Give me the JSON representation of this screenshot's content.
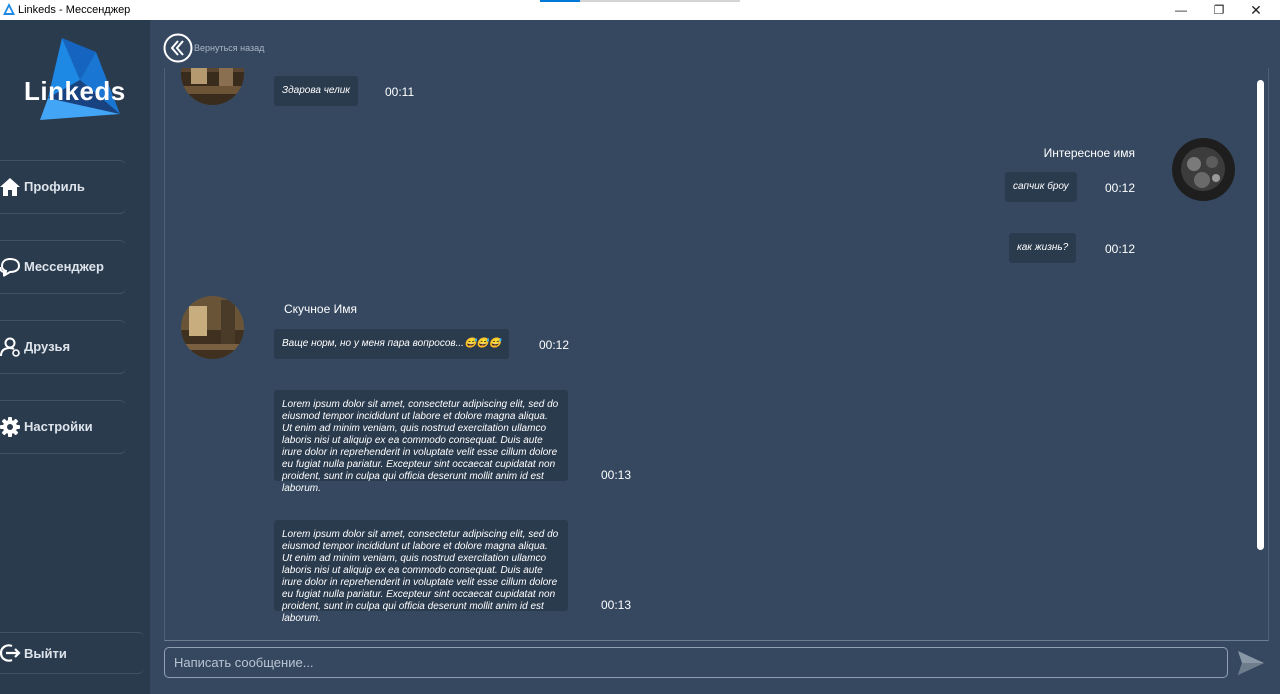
{
  "window": {
    "title": "Linkeds - Мессенджер",
    "minimize": "—",
    "maximize": "❐",
    "close": "✕"
  },
  "sidebar": {
    "logo_text": "Linkeds",
    "items": [
      {
        "label": "Профиль",
        "icon": "home-icon"
      },
      {
        "label": "Мессенджер",
        "icon": "chat-icon"
      },
      {
        "label": "Друзья",
        "icon": "user-icon"
      },
      {
        "label": "Настройки",
        "icon": "gear-icon"
      }
    ],
    "logout": {
      "label": "Выйти",
      "icon": "logout-icon"
    }
  },
  "header": {
    "back_label": "Вернуться назад"
  },
  "messages": [
    {
      "side": "left",
      "sender": "",
      "text": "Здарова челик",
      "time": "00:11"
    },
    {
      "side": "right",
      "sender": "Интересное имя",
      "text": "сапчик броу",
      "time": "00:12"
    },
    {
      "side": "right",
      "sender": "",
      "text": "как жизнь?",
      "time": "00:12"
    },
    {
      "side": "left",
      "sender": "Скучное Имя",
      "text": "Ваще норм, но у меня пара вопросов...😅😅😅",
      "time": "00:12"
    },
    {
      "side": "left",
      "sender": "",
      "text": "Lorem ipsum dolor sit amet, consectetur adipiscing elit, sed do eiusmod tempor incididunt ut labore et dolore magna aliqua. Ut enim ad minim veniam, quis nostrud exercitation ullamco laboris nisi ut aliquip ex ea commodo consequat. Duis aute irure dolor in reprehenderit in voluptate velit esse cillum dolore eu fugiat nulla pariatur. Excepteur sint occaecat cupidatat non proident, sunt in culpa qui officia deserunt mollit anim id est laborum.",
      "time": "00:13"
    },
    {
      "side": "left",
      "sender": "",
      "text": "Lorem ipsum dolor sit amet, consectetur adipiscing elit, sed do eiusmod tempor incididunt ut labore et dolore magna aliqua. Ut enim ad minim veniam, quis nostrud exercitation ullamco laboris nisi ut aliquip ex ea commodo consequat. Duis aute irure dolor in reprehenderit in voluptate velit esse cillum dolore eu fugiat nulla pariatur. Excepteur sint occaecat cupidatat non proident, sunt in culpa qui officia deserunt mollit anim id est laborum.",
      "time": "00:13"
    }
  ],
  "composer": {
    "placeholder": "Написать сообщение..."
  },
  "colors": {
    "background": "#354860",
    "sidebar": "#2b3b4e",
    "bubble": "#2b3b4e",
    "logo_blue": "#1e88e5"
  }
}
